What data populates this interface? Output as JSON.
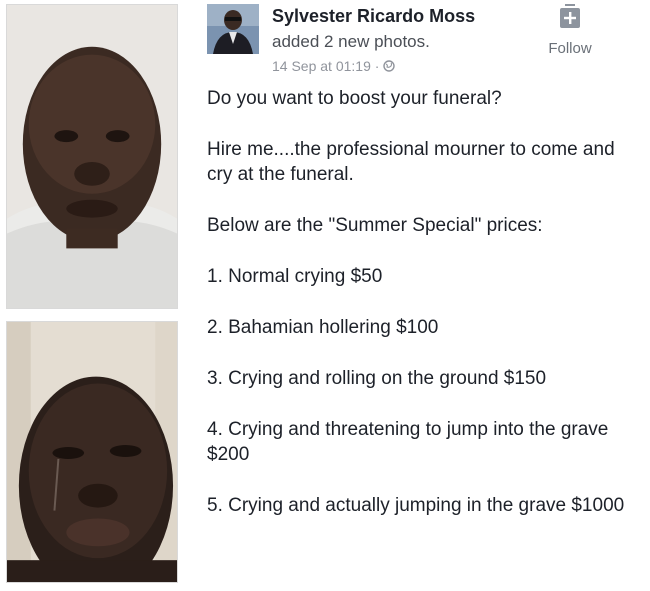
{
  "post": {
    "author": "Sylvester Ricardo Moss",
    "action": "added 2 new photos.",
    "timestamp": "14 Sep at 01:19 ·",
    "privacy_icon": "globe-icon",
    "follow_label": "Follow",
    "follow_icon": "add-friend-icon",
    "paragraphs": [
      "Do you want to boost your funeral?",
      "Hire me....the professional mourner to come and cry at the funeral.",
      "Below are the \"Summer Special\"  prices:",
      "1. Normal crying $50",
      "2. Bahamian hollering $100",
      "3. Crying and rolling on the ground $150",
      "4. Crying and threatening to jump into the grave $200",
      "5. Crying and actually jumping in the grave $1000"
    ]
  },
  "colors": {
    "name": "#1d2129",
    "secondary": "#4b4f56",
    "meta": "#90949c"
  }
}
